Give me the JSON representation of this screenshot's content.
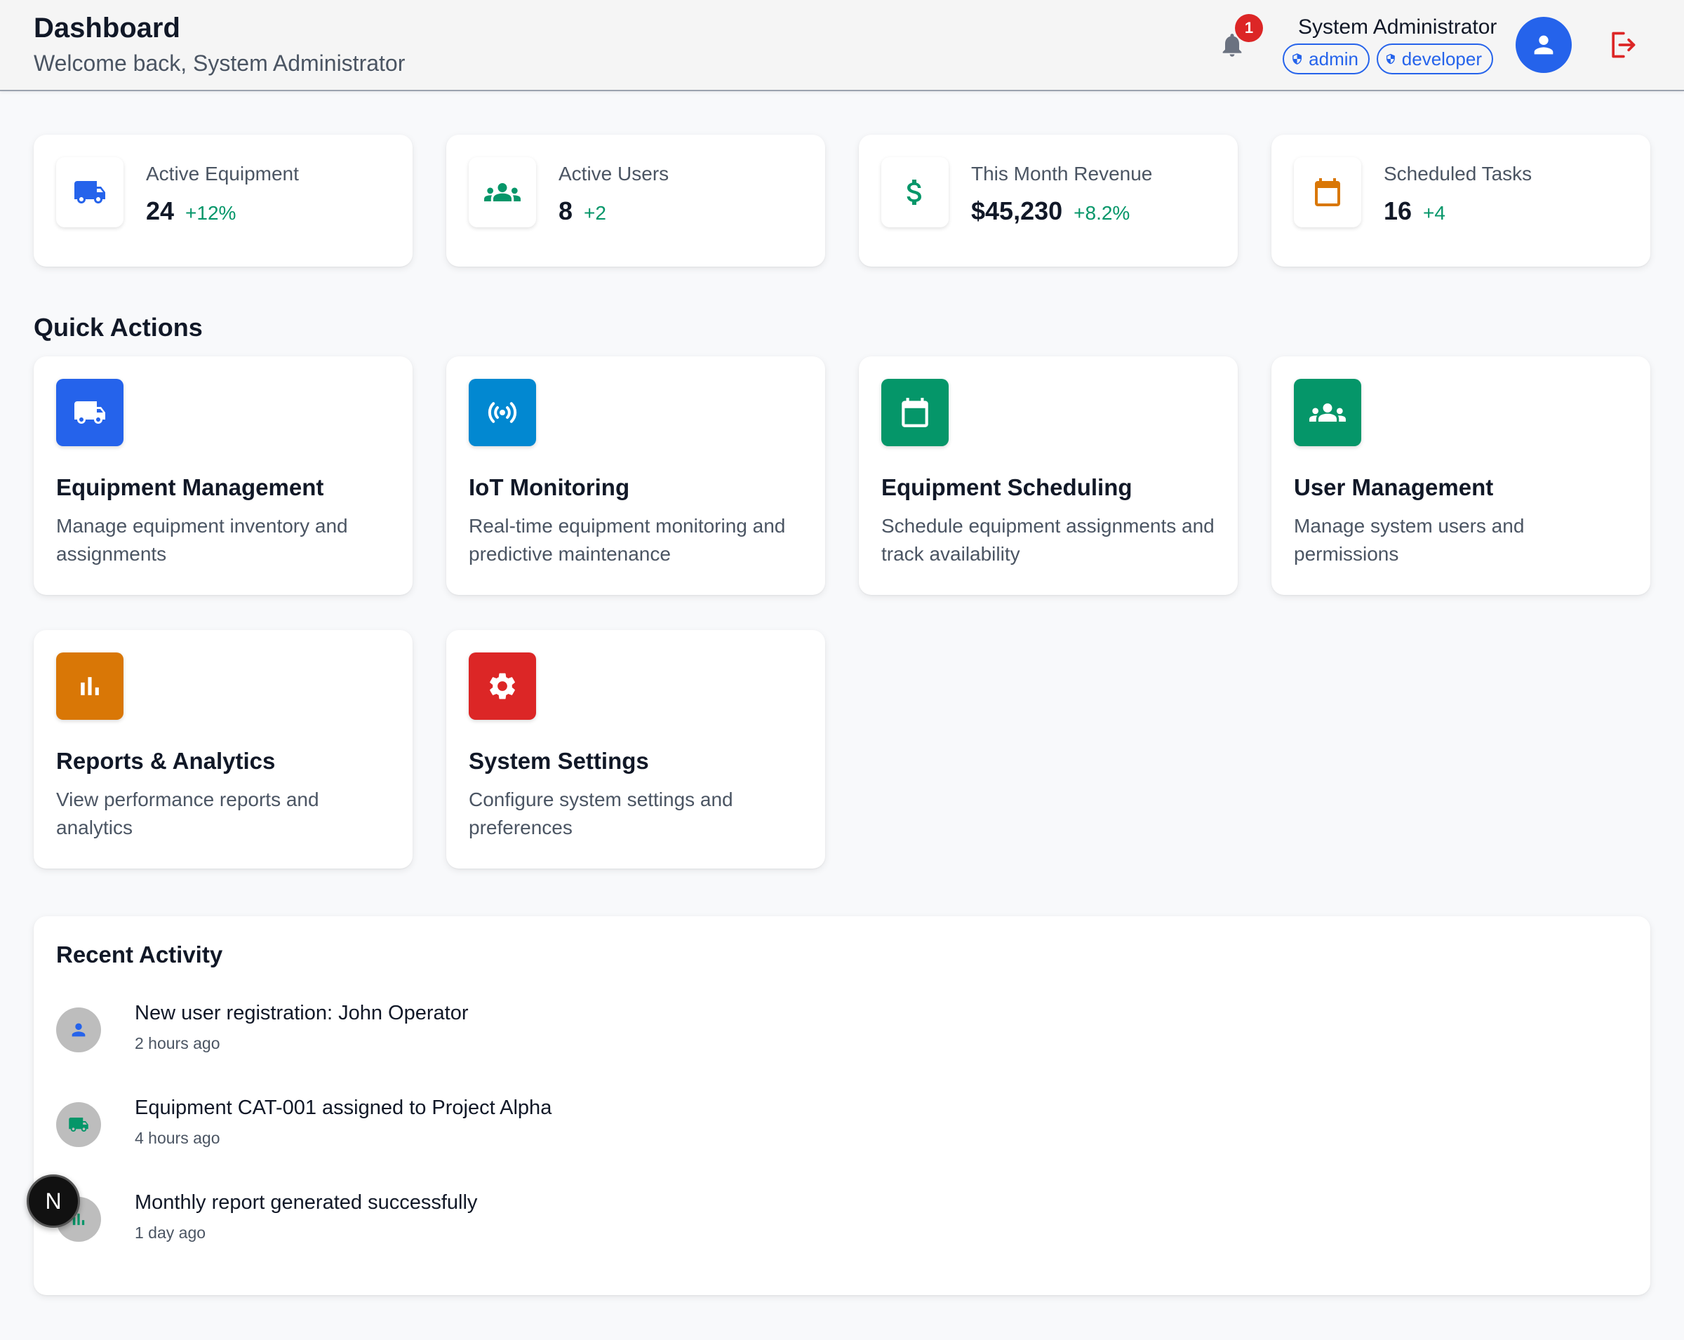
{
  "header": {
    "title": "Dashboard",
    "subtitle": "Welcome back, System Administrator",
    "notification_count": "1",
    "user_name": "System Administrator",
    "roles": [
      "admin",
      "developer"
    ]
  },
  "stats": [
    {
      "label": "Active Equipment",
      "value": "24",
      "change": "+12%",
      "icon": "truck-icon",
      "color": "#2563eb"
    },
    {
      "label": "Active Users",
      "value": "8",
      "change": "+2",
      "icon": "users-icon",
      "color": "#059669"
    },
    {
      "label": "This Month Revenue",
      "value": "$45,230",
      "change": "+8.2%",
      "icon": "dollar-icon",
      "color": "#059669"
    },
    {
      "label": "Scheduled Tasks",
      "value": "16",
      "change": "+4",
      "icon": "calendar-icon",
      "color": "#d97706"
    }
  ],
  "quick_actions": {
    "title": "Quick Actions",
    "items": [
      {
        "title": "Equipment Management",
        "description": "Manage equipment inventory and assignments",
        "icon": "truck-icon",
        "color": "#2563eb"
      },
      {
        "title": "IoT Monitoring",
        "description": "Real-time equipment monitoring and predictive maintenance",
        "icon": "sensor-icon",
        "color": "#0288d1"
      },
      {
        "title": "Equipment Scheduling",
        "description": "Schedule equipment assignments and track availability",
        "icon": "calendar-icon",
        "color": "#059669"
      },
      {
        "title": "User Management",
        "description": "Manage system users and permissions",
        "icon": "users-icon",
        "color": "#059669"
      },
      {
        "title": "Reports & Analytics",
        "description": "View performance reports and analytics",
        "icon": "bar-chart-icon",
        "color": "#d97706"
      },
      {
        "title": "System Settings",
        "description": "Configure system settings and preferences",
        "icon": "gear-icon",
        "color": "#dc2626"
      }
    ]
  },
  "recent_activity": {
    "title": "Recent Activity",
    "items": [
      {
        "text": "New user registration: John Operator",
        "time": "2 hours ago",
        "icon": "person-icon",
        "color": "#2563eb"
      },
      {
        "text": "Equipment CAT-001 assigned to Project Alpha",
        "time": "4 hours ago",
        "icon": "truck-icon",
        "color": "#059669"
      },
      {
        "text": "Monthly report generated successfully",
        "time": "1 day ago",
        "icon": "bar-chart-icon",
        "color": "#059669"
      }
    ]
  },
  "dev_badge": {
    "label": "N"
  }
}
